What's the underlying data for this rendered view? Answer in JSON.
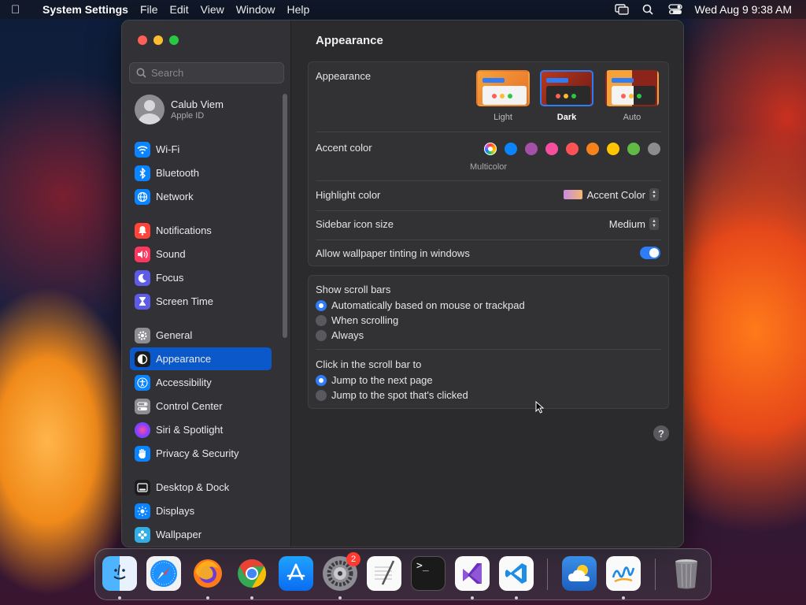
{
  "menubar": {
    "app_name": "System Settings",
    "items": [
      "File",
      "Edit",
      "View",
      "Window",
      "Help"
    ],
    "clock": "Wed Aug 9  9:38 AM"
  },
  "sidebar": {
    "search_placeholder": "Search",
    "profile": {
      "name": "Calub Viem",
      "subtitle": "Apple ID"
    },
    "items": [
      {
        "label": "Wi-Fi",
        "icon": "wifi-icon",
        "color": "#0a84ff"
      },
      {
        "label": "Bluetooth",
        "icon": "bluetooth-icon",
        "color": "#0a84ff"
      },
      {
        "label": "Network",
        "icon": "globe-icon",
        "color": "#0a84ff"
      },
      {
        "label": "Notifications",
        "icon": "bell-icon",
        "color": "#ff453a"
      },
      {
        "label": "Sound",
        "icon": "speaker-icon",
        "color": "#ff375f"
      },
      {
        "label": "Focus",
        "icon": "moon-icon",
        "color": "#5e5ce6"
      },
      {
        "label": "Screen Time",
        "icon": "hourglass-icon",
        "color": "#5e5ce6"
      },
      {
        "label": "General",
        "icon": "gear-icon",
        "color": "#8e8e93"
      },
      {
        "label": "Appearance",
        "icon": "appearance-icon",
        "color": "#1c1c1e"
      },
      {
        "label": "Accessibility",
        "icon": "accessibility-icon",
        "color": "#0a84ff"
      },
      {
        "label": "Control Center",
        "icon": "control-center-icon",
        "color": "#8e8e93"
      },
      {
        "label": "Siri & Spotlight",
        "icon": "siri-icon",
        "color": "#bf5af2"
      },
      {
        "label": "Privacy & Security",
        "icon": "hand-icon",
        "color": "#0a84ff"
      },
      {
        "label": "Desktop & Dock",
        "icon": "dock-icon",
        "color": "#1c1c1e"
      },
      {
        "label": "Displays",
        "icon": "sun-icon",
        "color": "#0a84ff"
      },
      {
        "label": "Wallpaper",
        "icon": "flower-icon",
        "color": "#32ade6"
      }
    ],
    "selected": "Appearance"
  },
  "main": {
    "title": "Appearance",
    "appearance": {
      "label": "Appearance",
      "options": [
        "Light",
        "Dark",
        "Auto"
      ],
      "selected": "Dark"
    },
    "accent": {
      "label": "Accent color",
      "colors": [
        "#0a84ff",
        "#a550a7",
        "#f74f9e",
        "#ff5257",
        "#f7821b",
        "#ffc600",
        "#62ba46",
        "#8c8c8c"
      ],
      "selected_label": "Multicolor"
    },
    "highlight": {
      "label": "Highlight color",
      "value": "Accent Color"
    },
    "sidebar_icon_size": {
      "label": "Sidebar icon size",
      "value": "Medium"
    },
    "wallpaper_tinting": {
      "label": "Allow wallpaper tinting in windows",
      "enabled": true
    },
    "scroll_bars": {
      "label": "Show scroll bars",
      "options": [
        "Automatically based on mouse or trackpad",
        "When scrolling",
        "Always"
      ],
      "selected": "Automatically based on mouse or trackpad"
    },
    "click_scroll": {
      "label": "Click in the scroll bar to",
      "options": [
        "Jump to the next page",
        "Jump to the spot that's clicked"
      ],
      "selected": "Jump to the next page"
    },
    "help": "?"
  },
  "dock": {
    "apps": [
      "Finder",
      "Safari",
      "Firefox",
      "Chrome",
      "App Store",
      "System Settings",
      "TextEdit",
      "Terminal",
      "Visual Studio",
      "VS Code",
      "Weather",
      "Freeform",
      "Trash"
    ],
    "settings_badge": "2"
  }
}
